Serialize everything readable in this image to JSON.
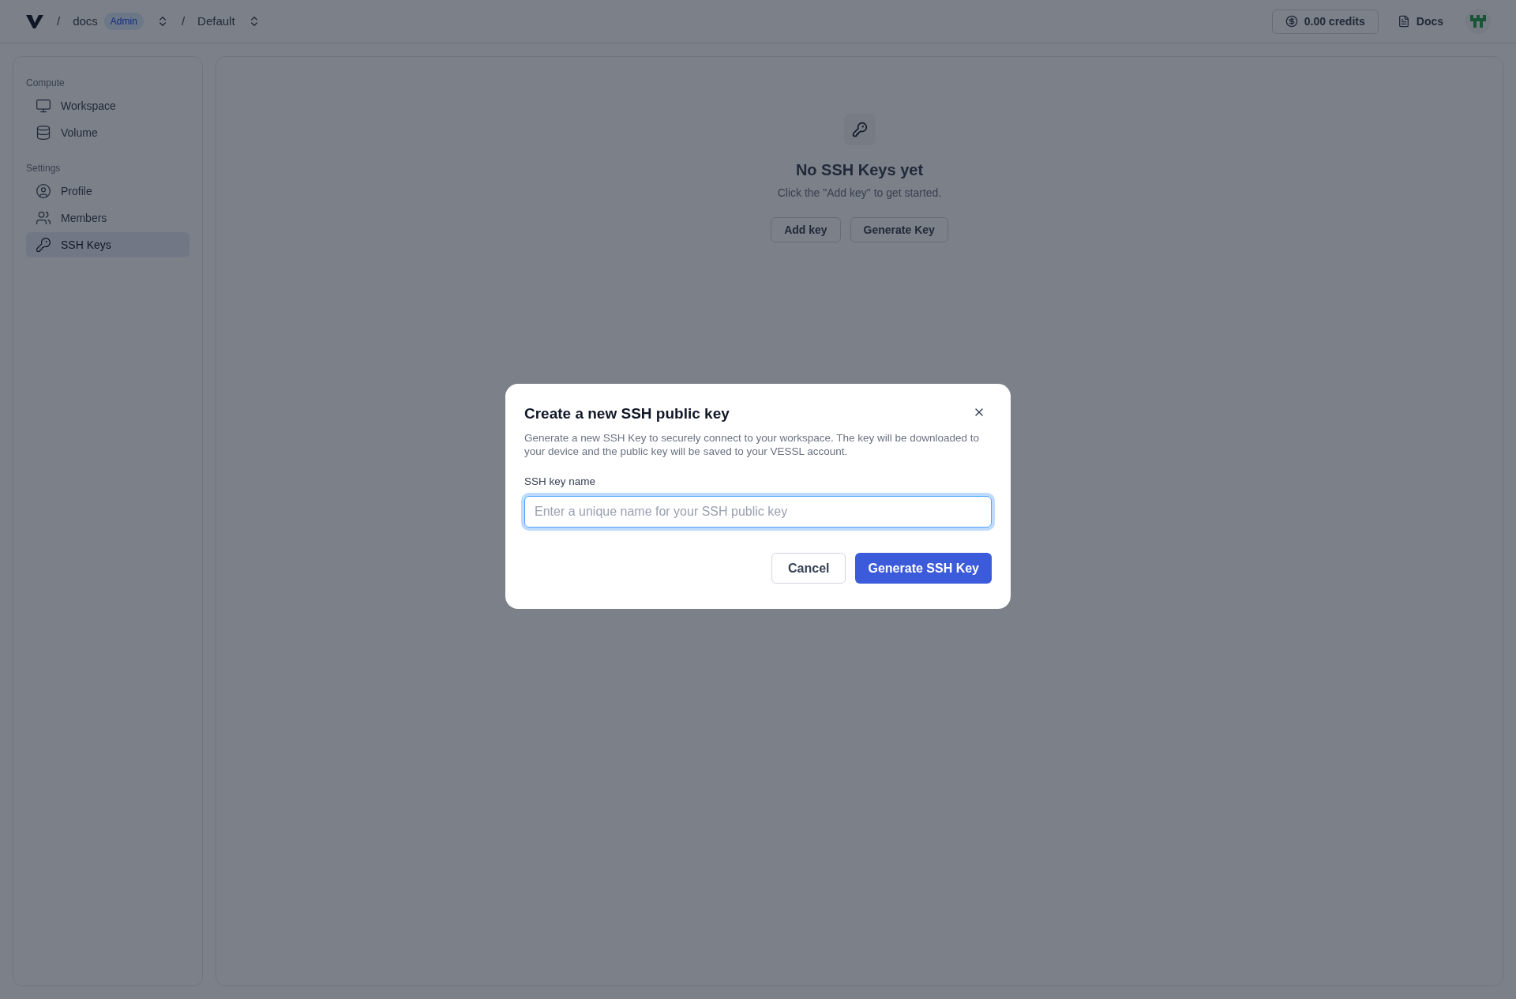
{
  "header": {
    "breadcrumbs": [
      {
        "separator": "/",
        "label": "docs",
        "badge": "Admin"
      },
      {
        "separator": "/",
        "label": "Default"
      }
    ],
    "credits": "0.00 credits",
    "docs_link": "Docs"
  },
  "sidebar": {
    "sections": [
      {
        "title": "Compute",
        "items": [
          {
            "label": "Workspace",
            "kind": "monitor",
            "selected": false
          },
          {
            "label": "Volume",
            "kind": "database",
            "selected": false
          }
        ]
      },
      {
        "title": "Settings",
        "items": [
          {
            "label": "Profile",
            "kind": "user",
            "selected": false
          },
          {
            "label": "Members",
            "kind": "users",
            "selected": false
          },
          {
            "label": "SSH Keys",
            "kind": "key",
            "selected": true
          }
        ]
      }
    ]
  },
  "empty_state": {
    "title": "No SSH Keys yet",
    "text": "Click the \"Add key\" to get started.",
    "buttons": [
      "Add key",
      "Generate Key"
    ]
  },
  "dialog": {
    "title": "Create a new SSH public key",
    "description": "Generate a new SSH Key to securely connect to your workspace. The key will be downloaded to your device and the public key will be saved to your VESSL account.",
    "field": {
      "label": "SSH key name",
      "placeholder": "Enter a unique name for your SSH public key",
      "focused": true
    },
    "cancel": "Cancel",
    "submit": "Generate SSH Key"
  }
}
